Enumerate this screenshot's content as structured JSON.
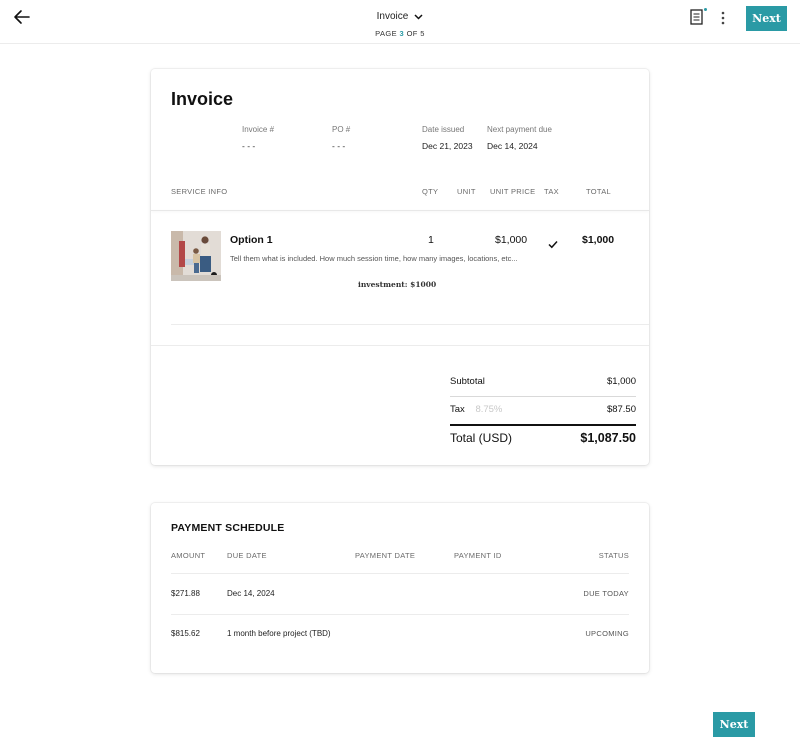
{
  "header": {
    "doc_title": "Invoice",
    "page_prefix": "PAGE",
    "page_current": "3",
    "page_suffix": "OF 5",
    "next_label": "Next",
    "accent_color": "#2a9aa5"
  },
  "invoice": {
    "title": "Invoice",
    "meta": [
      {
        "label": "Invoice #",
        "value": "- - -"
      },
      {
        "label": "PO #",
        "value": "- - -"
      },
      {
        "label": "Date issued",
        "value": "Dec 21, 2023"
      },
      {
        "label": "Next payment due",
        "value": "Dec 14, 2024"
      }
    ],
    "columns": {
      "service": "SERVICE INFO",
      "qty": "QTY",
      "unit": "UNIT",
      "unit_price": "UNIT PRICE",
      "tax": "TAX",
      "total": "TOTAL"
    },
    "items": [
      {
        "name": "Option 1",
        "description": "Tell them what is included.  How much session time, how many images, locations, etc...",
        "note": "investment: $1000",
        "qty": "1",
        "unit_price": "$1,000",
        "taxable_icon": "check-icon",
        "total": "$1,000"
      }
    ],
    "totals": {
      "subtotal_label": "Subtotal",
      "subtotal_value": "$1,000",
      "tax_label": "Tax",
      "tax_rate": "8.75%",
      "tax_value": "$87.50",
      "total_label": "Total (USD)",
      "total_value": "$1,087.50"
    }
  },
  "schedule": {
    "title": "PAYMENT SCHEDULE",
    "columns": {
      "amount": "AMOUNT",
      "due_date": "DUE DATE",
      "payment_date": "PAYMENT DATE",
      "payment_id": "PAYMENT ID",
      "status": "STATUS"
    },
    "rows": [
      {
        "amount": "$271.88",
        "due_date": "Dec 14, 2024",
        "status": "DUE TODAY"
      },
      {
        "amount": "$815.62",
        "due_date": "1 month before project (TBD)",
        "status": "UPCOMING"
      }
    ]
  },
  "footer": {
    "next_label": "Next"
  }
}
